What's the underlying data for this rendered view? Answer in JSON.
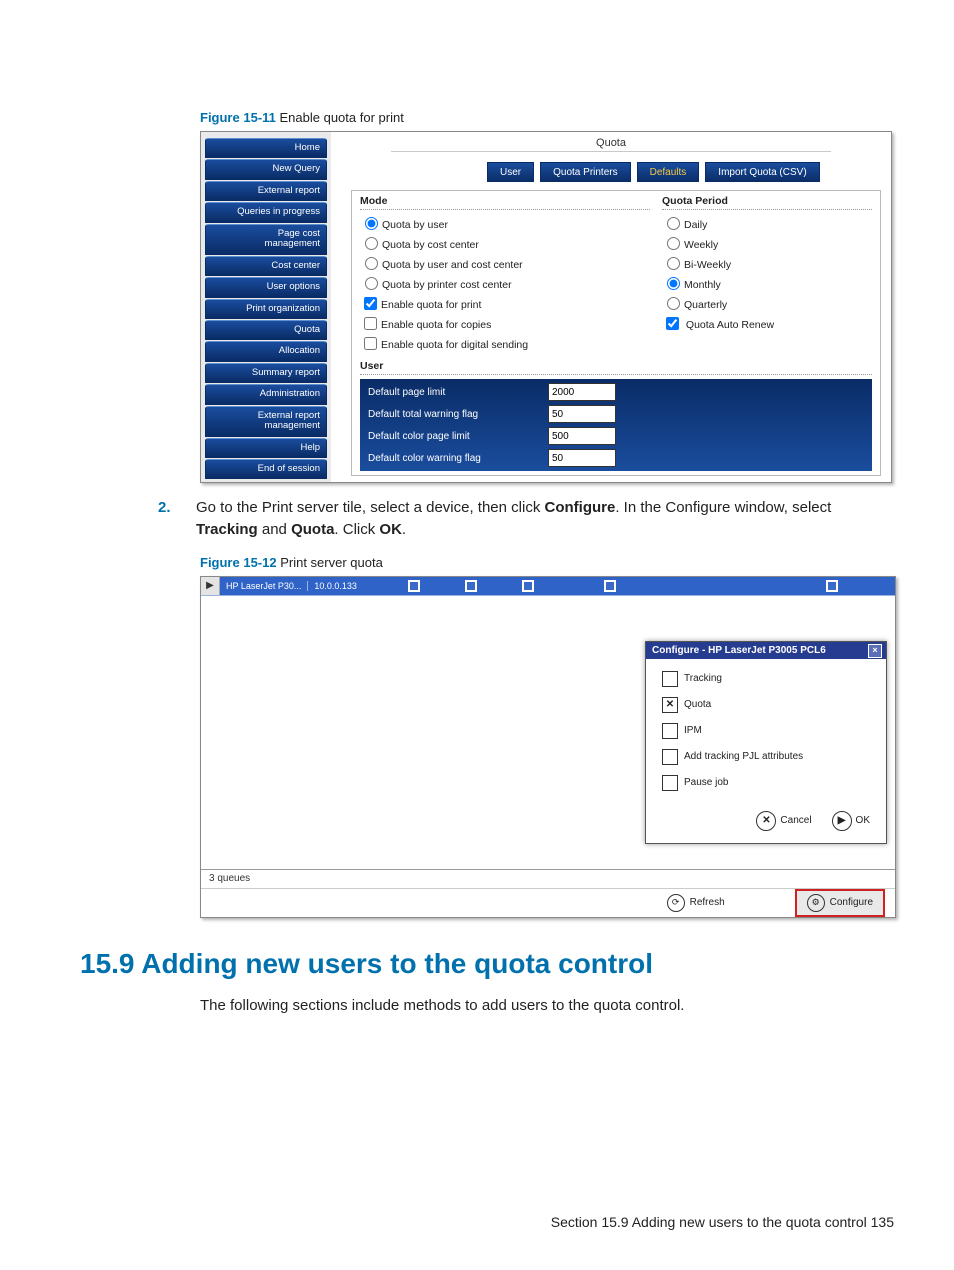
{
  "figure11": {
    "caption_num": "Figure 15-11",
    "caption_text": "Enable quota for print",
    "sidebar": [
      "Home",
      "New Query",
      "External report",
      "Queries in progress",
      "Page cost\nmanagement",
      "Cost center",
      "User options",
      "Print organization",
      "Quota",
      "Allocation",
      "Summary report",
      "Administration",
      "External report\nmanagement",
      "Help",
      "End of session"
    ],
    "title": "Quota",
    "tabs": [
      "User",
      "Quota Printers",
      "Defaults",
      "Import Quota (CSV)"
    ],
    "mode_label": "Mode",
    "modes": [
      "Quota by user",
      "Quota by cost center",
      "Quota by user and cost center",
      "Quota by printer cost center"
    ],
    "mode_selected": 0,
    "checks": [
      {
        "label": "Enable quota for print",
        "checked": true
      },
      {
        "label": "Enable quota for copies",
        "checked": false
      },
      {
        "label": "Enable quota for digital sending",
        "checked": false
      }
    ],
    "period_label": "Quota Period",
    "periods": [
      "Daily",
      "Weekly",
      "Bi-Weekly",
      "Monthly",
      "Quarterly"
    ],
    "period_selected": 3,
    "auto_renew": {
      "label": "Quota Auto Renew",
      "checked": true
    },
    "user_label": "User",
    "user_rows": [
      {
        "label": "Default page limit",
        "value": "2000"
      },
      {
        "label": "Default total warning flag",
        "value": "50"
      },
      {
        "label": "Default color page limit",
        "value": "500"
      },
      {
        "label": "Default color warning flag",
        "value": "50"
      }
    ]
  },
  "step": {
    "num": "2.",
    "text_parts": [
      "Go to the Print server tile, select a device, then click ",
      "Configure",
      ". In the Configure window, select ",
      "Tracking",
      " and ",
      "Quota",
      ". Click ",
      "OK",
      "."
    ]
  },
  "figure12": {
    "caption_num": "Figure 15-12",
    "caption_text": "Print server quota",
    "device_name": "HP LaserJet P30...",
    "device_ip": "10.0.0.133",
    "arrow": "▶",
    "dialog_title": "Configure - HP LaserJet P3005 PCL6",
    "options": [
      {
        "label": "Tracking",
        "checked": false
      },
      {
        "label": "Quota",
        "checked": true
      },
      {
        "label": "IPM",
        "checked": false
      },
      {
        "label": "Add tracking PJL attributes",
        "checked": false
      },
      {
        "label": "Pause job",
        "checked": false
      }
    ],
    "cancel_label": "Cancel",
    "ok_label": "OK",
    "queues_text": "3 queues",
    "refresh_label": "Refresh",
    "configure_label": "Configure"
  },
  "section": {
    "heading": "15.9 Adding new users to the quota control",
    "body": "The following sections include methods to add users to the quota control."
  },
  "footer": {
    "text": "Section 15.9   Adding new users to the quota control   135"
  }
}
